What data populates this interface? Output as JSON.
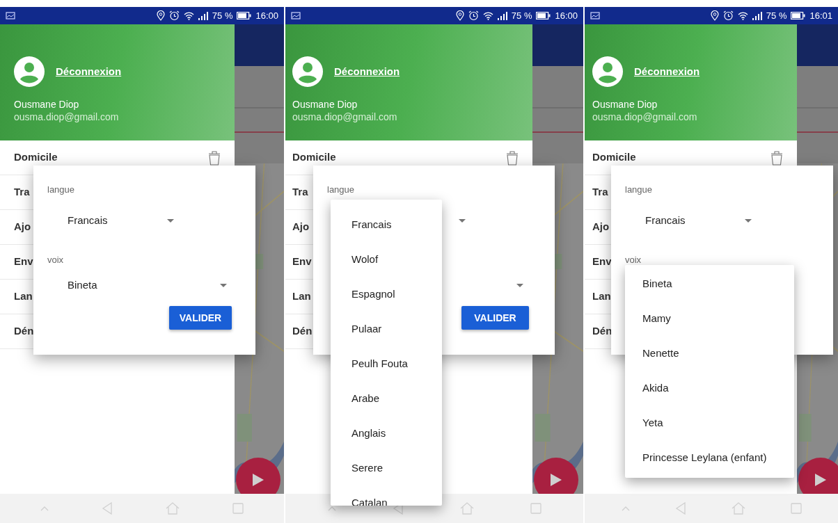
{
  "screens": [
    {
      "status_bar": {
        "battery": "75 %",
        "time": "16:00"
      },
      "drawer": {
        "logout_link": "Déconnexion",
        "user_name": "Ousmane Diop",
        "user_email": "ousma.diop@gmail.com",
        "items": [
          "Domicile",
          "Tra",
          "Ajo",
          "Env",
          "Lan",
          "Dén"
        ]
      },
      "dialog": {
        "language_label": "langue",
        "language_value": "Francais",
        "voice_label": "voix",
        "voice_value": "Bineta",
        "button": "VALIDER"
      }
    },
    {
      "status_bar": {
        "battery": "75 %",
        "time": "16:00"
      },
      "drawer": {
        "logout_link": "Déconnexion",
        "user_name": "Ousmane Diop",
        "user_email": "ousma.diop@gmail.com",
        "items": [
          "Domicile",
          "Tra",
          "Ajo",
          "Env",
          "Lan",
          "Dén"
        ]
      },
      "dialog": {
        "language_label": "langue",
        "button": "VALIDER"
      },
      "open_list": {
        "kind": "language",
        "options": [
          "Francais",
          "Wolof",
          "Espagnol",
          "Pulaar",
          "Peulh Fouta",
          "Arabe",
          "Anglais",
          "Serere",
          "Catalan"
        ]
      }
    },
    {
      "status_bar": {
        "battery": "75 %",
        "time": "16:01"
      },
      "drawer": {
        "logout_link": "Déconnexion",
        "user_name": "Ousmane Diop",
        "user_email": "ousma.diop@gmail.com",
        "items": [
          "Domicile",
          "Tra",
          "Ajo",
          "Env",
          "Lan",
          "Dén"
        ]
      },
      "dialog": {
        "language_label": "langue",
        "language_value": "Francais",
        "voice_label": "voix"
      },
      "open_list": {
        "kind": "voice",
        "options": [
          "Bineta",
          "Mamy",
          "Nenette",
          "Akida",
          "Yeta",
          "Princesse Leylana (enfant)"
        ]
      }
    }
  ]
}
